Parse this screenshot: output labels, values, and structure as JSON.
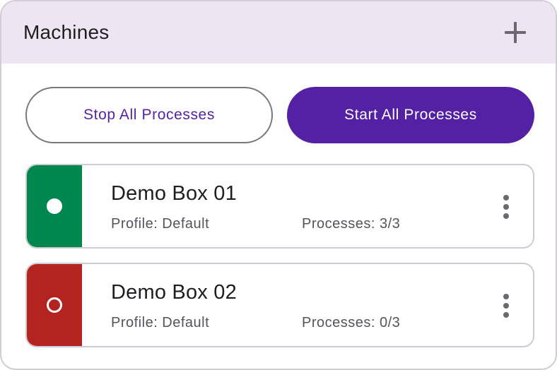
{
  "header": {
    "title": "Machines",
    "add_icon": "plus-icon"
  },
  "actions": {
    "stop_label": "Stop All Processes",
    "start_label": "Start All Processes"
  },
  "machines": [
    {
      "name": "Demo Box 01",
      "profile": "Profile: Default",
      "processes": "Processes: 3/3",
      "status": "running",
      "status_color": "#00874f",
      "status_icon": "filled-circle-icon"
    },
    {
      "name": "Demo Box 02",
      "profile": "Profile: Default",
      "processes": "Processes: 0/3",
      "status": "stopped",
      "status_color": "#b3231f",
      "status_icon": "hollow-circle-icon"
    }
  ],
  "colors": {
    "header_bg": "#ede5f2",
    "primary": "#5420a4",
    "primary_text": "#5522a6"
  }
}
